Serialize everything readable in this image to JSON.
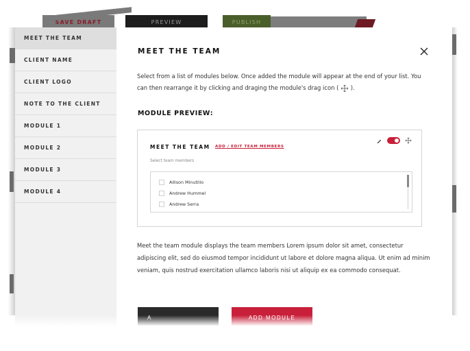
{
  "topbar": {
    "save_draft": "SAVE DRAFT",
    "preview": "PREVIEW",
    "publish": "PUBLISH"
  },
  "sidebar": {
    "items": [
      {
        "label": "MEET THE TEAM",
        "active": true
      },
      {
        "label": "CLIENT NAME"
      },
      {
        "label": "CLIENT LOGO"
      },
      {
        "label": "NOTE TO THE CLIENT"
      },
      {
        "label": "MODULE 1"
      },
      {
        "label": "MODULE 2"
      },
      {
        "label": "MODULE 3"
      },
      {
        "label": "MODULE 4"
      }
    ]
  },
  "main": {
    "title": "MEET THE TEAM",
    "close_icon": "close-icon",
    "intro_part1": "Select from a list of modules below. Once added the module will appear at the end of your list. You can then rearrange it by clicking and draging the module's drag icon (",
    "intro_part2": ").",
    "preview_heading": "MODULE PREVIEW:",
    "card": {
      "title": "MEET THE TEAM",
      "link": "ADD / EDIT TEAM MEMBERS",
      "subtitle": "Select team members",
      "toggle_on": true,
      "members": [
        {
          "name": "Allison Minutillo",
          "checked": false
        },
        {
          "name": "Andrew Hummel",
          "checked": false
        },
        {
          "name": "Andrew Serra",
          "checked": false
        }
      ]
    },
    "description": "Meet the team module displays the team members Lorem ipsum dolor sit amet, consectetur adipiscing elit, sed do eiusmod tempor incididunt ut labore et dolore magna aliqua. Ut enim ad minim veniam, quis nostrud exercitation ullamco laboris nisi ut aliquip ex ea commodo consequat.",
    "back_button": "A",
    "add_button": "ADD MODULE"
  },
  "colors": {
    "accent": "#c8203a",
    "dark": "#2a2a2a",
    "sidebar_bg": "#f1f1f1",
    "sidebar_active": "#dedede"
  }
}
